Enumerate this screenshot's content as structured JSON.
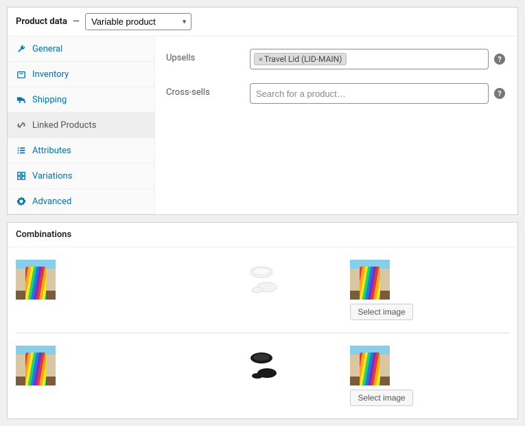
{
  "header": {
    "title": "Product data",
    "dash": "—",
    "product_type": "Variable product"
  },
  "tabs": [
    {
      "key": "general",
      "label": "General",
      "icon": "wrench-icon"
    },
    {
      "key": "inventory",
      "label": "Inventory",
      "icon": "inventory-icon"
    },
    {
      "key": "shipping",
      "label": "Shipping",
      "icon": "truck-icon"
    },
    {
      "key": "linked",
      "label": "Linked Products",
      "icon": "link-icon",
      "active": true
    },
    {
      "key": "attributes",
      "label": "Attributes",
      "icon": "list-icon"
    },
    {
      "key": "variations",
      "label": "Variations",
      "icon": "grid-icon"
    },
    {
      "key": "advanced",
      "label": "Advanced",
      "icon": "gear-icon"
    }
  ],
  "linked": {
    "upsells_label": "Upsells",
    "cross_sells_label": "Cross-sells",
    "upsell_tags": [
      {
        "label": "Travel Lid (LID-MAIN)"
      }
    ],
    "cross_sells_placeholder": "Search for a product…"
  },
  "combinations": {
    "title": "Combinations",
    "rows": [
      {
        "variant_lid": "white",
        "select_image_label": "Select image"
      },
      {
        "variant_lid": "black",
        "select_image_label": "Select image"
      }
    ]
  }
}
